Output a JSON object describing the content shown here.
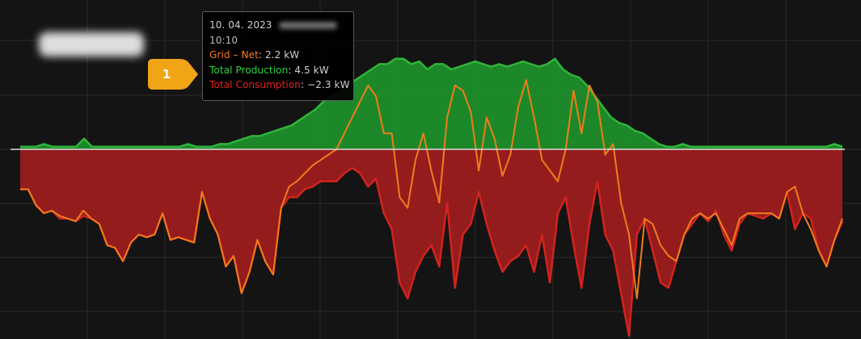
{
  "chart_data": {
    "type": "area",
    "grid": true,
    "legend": "none",
    "ylim": [
      -3.5,
      2.0
    ],
    "x_labels_visible": false,
    "series": [
      {
        "name": "Total Production",
        "color": "#1e8e2a",
        "line_color": "#2fb539",
        "fill_sign": "positive",
        "values": [
          0.05,
          0.05,
          0.05,
          0.1,
          0.05,
          0.05,
          0.05,
          0.05,
          0.2,
          0.05,
          0.05,
          0.05,
          0.05,
          0.05,
          0.05,
          0.05,
          0.05,
          0.05,
          0.05,
          0.05,
          0.05,
          0.1,
          0.05,
          0.05,
          0.05,
          0.1,
          0.1,
          0.15,
          0.2,
          0.25,
          0.25,
          0.3,
          0.35,
          0.4,
          0.45,
          0.55,
          0.65,
          0.75,
          0.9,
          1.0,
          1.1,
          1.2,
          1.3,
          1.4,
          1.5,
          1.6,
          1.6,
          1.7,
          1.7,
          1.6,
          1.65,
          1.5,
          1.6,
          1.6,
          1.5,
          1.55,
          1.6,
          1.65,
          1.6,
          1.55,
          1.6,
          1.55,
          1.6,
          1.65,
          1.6,
          1.55,
          1.6,
          1.7,
          1.5,
          1.4,
          1.35,
          1.2,
          1.0,
          0.8,
          0.6,
          0.5,
          0.45,
          0.35,
          0.3,
          0.2,
          0.1,
          0.05,
          0.05,
          0.1,
          0.05,
          0.05,
          0.05,
          0.05,
          0.05,
          0.05,
          0.05,
          0.05,
          0.05,
          0.05,
          0.05,
          0.05,
          0.05,
          0.05,
          0.05,
          0.05,
          0.05,
          0.05,
          0.1,
          0.05
        ]
      },
      {
        "name": "Total Consumption",
        "color": "#9b1c1c",
        "line_color": "#d2231f",
        "fill_sign": "negative",
        "values": [
          -0.75,
          -0.75,
          -1.05,
          -1.2,
          -1.15,
          -1.3,
          -1.3,
          -1.35,
          -1.25,
          -1.3,
          -1.4,
          -1.8,
          -1.85,
          -2.1,
          -1.75,
          -1.6,
          -1.65,
          -1.6,
          -1.2,
          -1.7,
          -1.65,
          -1.7,
          -1.75,
          -0.8,
          -1.3,
          -1.6,
          -2.2,
          -2.0,
          -2.7,
          -2.3,
          -1.7,
          -2.1,
          -2.35,
          -1.1,
          -0.9,
          -0.9,
          -0.75,
          -0.7,
          -0.6,
          -0.6,
          -0.6,
          -0.45,
          -0.35,
          -0.45,
          -0.7,
          -0.55,
          -1.2,
          -1.5,
          -2.5,
          -2.8,
          -2.3,
          -2.0,
          -1.8,
          -2.2,
          -1.0,
          -2.6,
          -1.6,
          -1.4,
          -0.8,
          -1.4,
          -1.9,
          -2.3,
          -2.1,
          -2.0,
          -1.8,
          -2.3,
          -1.6,
          -2.5,
          -1.2,
          -0.9,
          -1.8,
          -2.6,
          -1.4,
          -0.6,
          -1.6,
          -1.9,
          -2.7,
          -3.5,
          -1.6,
          -1.3,
          -1.9,
          -2.5,
          -2.6,
          -2.1,
          -1.6,
          -1.4,
          -1.2,
          -1.35,
          -1.15,
          -1.6,
          -1.9,
          -1.4,
          -1.2,
          -1.25,
          -1.3,
          -1.2,
          -1.3,
          -0.8,
          -1.5,
          -1.2,
          -1.3,
          -1.9,
          -2.2,
          -1.7,
          -1.35
        ]
      },
      {
        "name": "Grid - Net",
        "color": "#f07d1c",
        "line_color": "#f07d1c",
        "fill_sign": "none",
        "values": [
          -0.75,
          -0.75,
          -1.05,
          -1.2,
          -1.15,
          -1.25,
          -1.3,
          -1.35,
          -1.15,
          -1.3,
          -1.4,
          -1.8,
          -1.85,
          -2.1,
          -1.75,
          -1.6,
          -1.65,
          -1.6,
          -1.2,
          -1.7,
          -1.65,
          -1.7,
          -1.75,
          -0.8,
          -1.3,
          -1.6,
          -2.2,
          -2.0,
          -2.7,
          -2.3,
          -1.7,
          -2.1,
          -2.35,
          -1.1,
          -0.7,
          -0.6,
          -0.45,
          -0.3,
          -0.2,
          -0.1,
          0.0,
          0.3,
          0.6,
          0.9,
          1.2,
          1.0,
          0.3,
          0.3,
          -0.9,
          -1.1,
          -0.2,
          0.3,
          -0.4,
          -1.0,
          0.6,
          1.2,
          1.1,
          0.7,
          -0.4,
          0.6,
          0.2,
          -0.5,
          -0.1,
          0.8,
          1.3,
          0.6,
          -0.2,
          -0.4,
          -0.6,
          0.0,
          1.1,
          0.3,
          1.2,
          0.9,
          -0.1,
          0.1,
          -1.0,
          -1.6,
          -2.8,
          -1.3,
          -1.4,
          -1.8,
          -2.0,
          -2.1,
          -1.6,
          -1.3,
          -1.2,
          -1.3,
          -1.2,
          -1.5,
          -1.8,
          -1.3,
          -1.2,
          -1.2,
          -1.2,
          -1.2,
          -1.3,
          -0.8,
          -0.7,
          -1.2,
          -1.5,
          -1.9,
          -2.2,
          -1.7,
          -1.3
        ]
      }
    ]
  },
  "tooltip": {
    "date": "10. 04. 2023",
    "time": "10:10",
    "rows": [
      {
        "label": "Grid – Net",
        "value": ": 2.2 kW",
        "color": "#ff7a1f"
      },
      {
        "label": "Total Production",
        "value": ": 4.5 kW",
        "color": "#2fd33c"
      },
      {
        "label": "Total Consumption",
        "value": ": −2.3 kW",
        "color": "#e0231f"
      }
    ]
  },
  "callout": {
    "number": "1",
    "color": "#f0a517"
  }
}
